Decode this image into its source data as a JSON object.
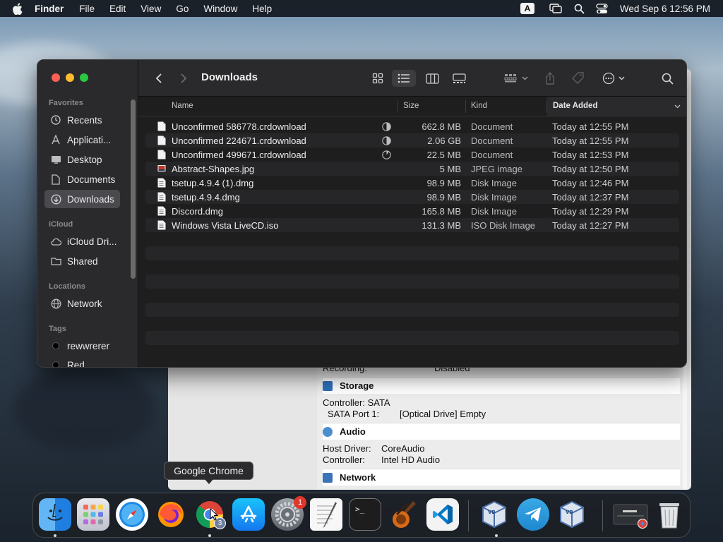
{
  "menubar": {
    "app": "Finder",
    "items": [
      "File",
      "Edit",
      "View",
      "Go",
      "Window",
      "Help"
    ],
    "input_indicator": "A",
    "datetime": "Wed Sep 6  12:56 PM"
  },
  "finder": {
    "title": "Downloads",
    "sidebar": {
      "favorites_header": "Favorites",
      "favorites": [
        {
          "label": "Recents",
          "icon": "clock-icon"
        },
        {
          "label": "Applicati...",
          "icon": "applications-icon"
        },
        {
          "label": "Desktop",
          "icon": "desktop-icon"
        },
        {
          "label": "Documents",
          "icon": "document-icon"
        },
        {
          "label": "Downloads",
          "icon": "download-icon",
          "active": true
        }
      ],
      "icloud_header": "iCloud",
      "icloud": [
        {
          "label": "iCloud Dri...",
          "icon": "cloud-icon"
        },
        {
          "label": "Shared",
          "icon": "shared-folder-icon"
        }
      ],
      "locations_header": "Locations",
      "locations": [
        {
          "label": "Network",
          "icon": "globe-icon"
        }
      ],
      "tags_header": "Tags",
      "tags": [
        {
          "label": "rewwrerer",
          "color": "#000000"
        },
        {
          "label": "Red",
          "color": "#000000"
        }
      ]
    },
    "columns": {
      "name": "Name",
      "size": "Size",
      "kind": "Kind",
      "date": "Date Added"
    },
    "files": [
      {
        "name": "Unconfirmed 586778.crdownload",
        "size": "662.8 MB",
        "kind": "Document",
        "date": "Today at 12:55 PM",
        "icon": "document-icon",
        "progress": 0.5
      },
      {
        "name": "Unconfirmed 224671.crdownload",
        "size": "2.06 GB",
        "kind": "Document",
        "date": "Today at 12:55 PM",
        "icon": "document-icon",
        "progress": 0.5
      },
      {
        "name": "Unconfirmed 499671.crdownload",
        "size": "22.5 MB",
        "kind": "Document",
        "date": "Today at 12:53 PM",
        "icon": "document-icon",
        "progress": 0.1
      },
      {
        "name": "Abstract-Shapes.jpg",
        "size": "5 MB",
        "kind": "JPEG image",
        "date": "Today at 12:50 PM",
        "icon": "image-icon"
      },
      {
        "name": "tsetup.4.9.4 (1).dmg",
        "size": "98.9 MB",
        "kind": "Disk Image",
        "date": "Today at 12:46 PM",
        "icon": "disk-image-icon"
      },
      {
        "name": "tsetup.4.9.4.dmg",
        "size": "98.9 MB",
        "kind": "Disk Image",
        "date": "Today at 12:37 PM",
        "icon": "disk-image-icon"
      },
      {
        "name": "Discord.dmg",
        "size": "165.8 MB",
        "kind": "Disk Image",
        "date": "Today at 12:29 PM",
        "icon": "disk-image-icon"
      },
      {
        "name": "Windows Vista LiveCD.iso",
        "size": "131.3 MB",
        "kind": "ISO Disk Image",
        "date": "Today at 12:27 PM",
        "icon": "disk-image-icon"
      }
    ]
  },
  "backwin": {
    "recording_label": "Recording:",
    "recording_value": "Disabled",
    "storage_title": "Storage",
    "storage_controller": "Controller: SATA",
    "storage_port_label": "SATA Port 1:",
    "storage_port_value": "[Optical Drive] Empty",
    "audio_title": "Audio",
    "audio_driver_label": "Host Driver:",
    "audio_driver_value": "CoreAudio",
    "audio_controller_label": "Controller:",
    "audio_controller_value": "Intel HD Audio",
    "network_title": "Network"
  },
  "tooltip": "Google Chrome",
  "dock": {
    "apps": [
      "Finder",
      "Launchpad",
      "Safari",
      "Firefox",
      "Google Chrome",
      "App Store",
      "System Settings",
      "TextEdit",
      "Terminal",
      "GarageBand",
      "Visual Studio Code",
      "VirtualBox",
      "Telegram",
      "VirtualBox VM",
      "Chrome App Window",
      "Trash"
    ],
    "settings_badge": "1",
    "chrome_profile_badge": "3"
  }
}
